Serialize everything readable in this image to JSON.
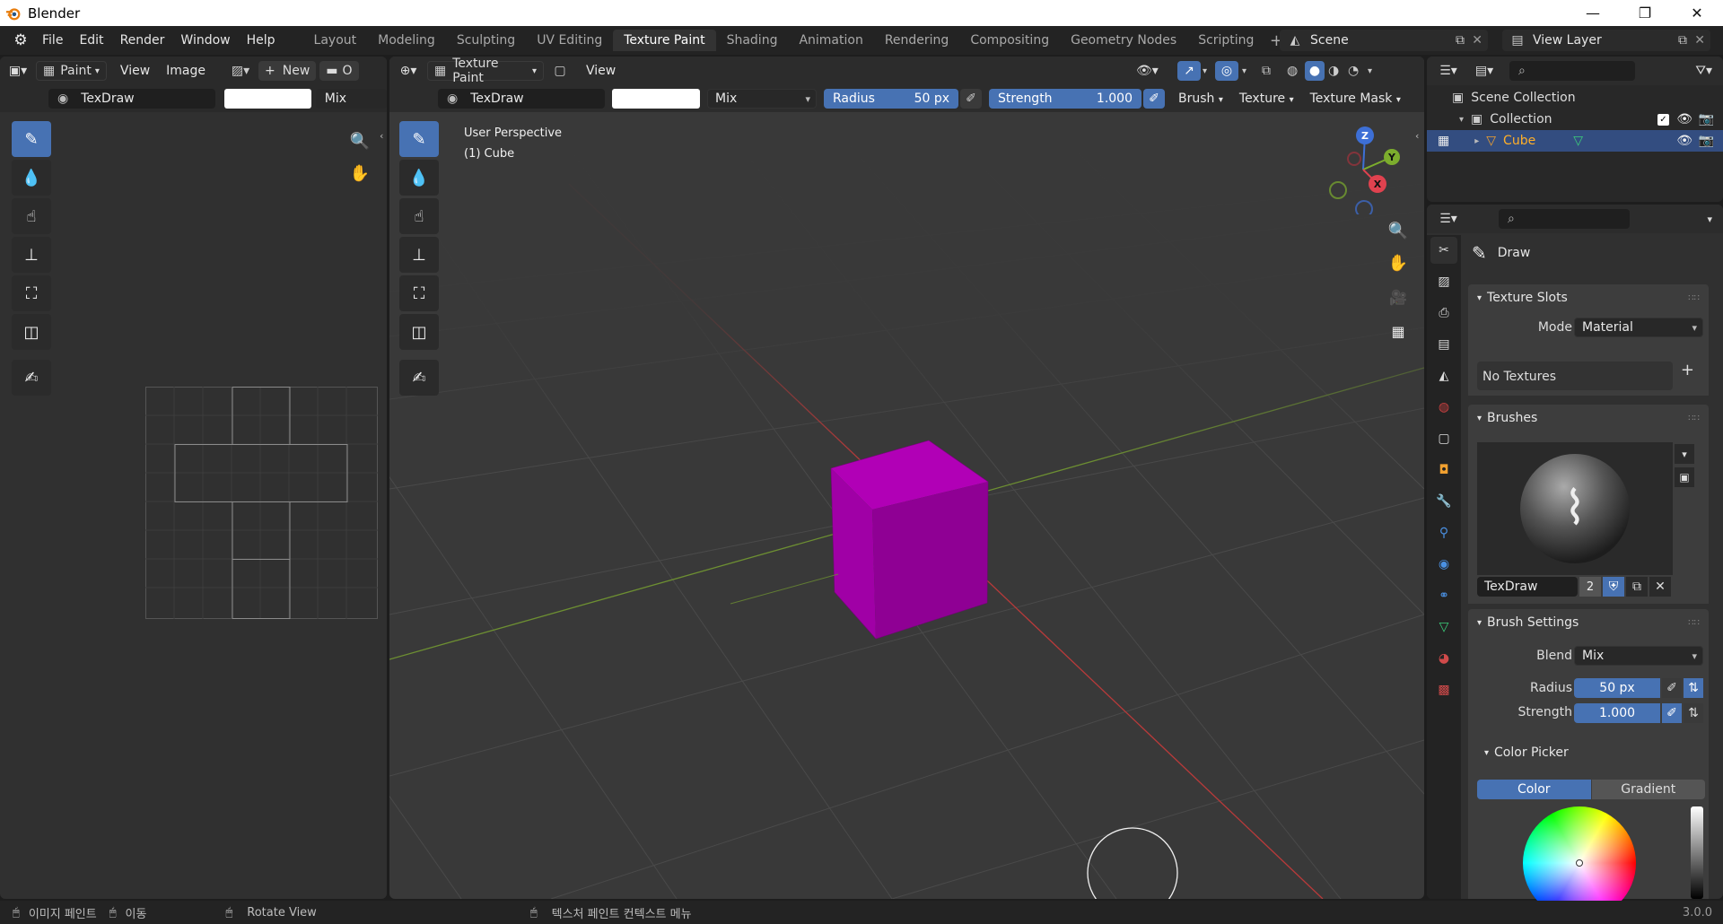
{
  "app": {
    "title": "Blender",
    "version": "3.0.0"
  },
  "menu": [
    "File",
    "Edit",
    "Render",
    "Window",
    "Help"
  ],
  "workspaces": [
    "Layout",
    "Modeling",
    "Sculpting",
    "UV Editing",
    "Texture Paint",
    "Shading",
    "Animation",
    "Rendering",
    "Compositing",
    "Geometry Nodes",
    "Scripting"
  ],
  "active_workspace": "Texture Paint",
  "scene": "Scene",
  "view_layer": "View Layer",
  "image_editor": {
    "mode": "Paint",
    "menus": [
      "View",
      "Image"
    ],
    "new_label": "New",
    "open_label": "O",
    "brush_name": "TexDraw",
    "blend": "Mix"
  },
  "viewport": {
    "mode": "Texture Paint",
    "menus": [
      "View"
    ],
    "brush_name": "TexDraw",
    "blend": "Mix",
    "radius_label": "Radius",
    "radius_value": "50 px",
    "strength_label": "Strength",
    "strength_value": "1.000",
    "brush_menu": "Brush",
    "texture_menu": "Texture",
    "texture_mask_menu": "Texture Mask",
    "overlay_title": "User Perspective",
    "overlay_object": "(1) Cube",
    "cube_color": "#a100a6",
    "gizmo": {
      "z": "Z",
      "y": "Y",
      "x": "X"
    }
  },
  "outliner": {
    "rows": [
      {
        "label": "Scene Collection"
      },
      {
        "label": "Collection"
      },
      {
        "label": "Cube"
      }
    ]
  },
  "properties": {
    "active_tool": "Draw",
    "texture_slots": {
      "title": "Texture Slots",
      "mode_label": "Mode",
      "mode_value": "Material",
      "empty": "No Textures"
    },
    "brushes": {
      "title": "Brushes",
      "brush_name": "TexDraw",
      "users": "2"
    },
    "brush_settings": {
      "title": "Brush Settings",
      "blend_label": "Blend",
      "blend_value": "Mix",
      "radius_label": "Radius",
      "radius_value": "50 px",
      "strength_label": "Strength",
      "strength_value": "1.000"
    },
    "color_picker": {
      "title": "Color Picker",
      "tab_color": "Color",
      "tab_gradient": "Gradient"
    }
  },
  "status": {
    "item1": "이미지 페인트",
    "item2": "이동",
    "item3": "Rotate View",
    "item4": "텍스처 페인트 컨텍스트 메뉴"
  }
}
